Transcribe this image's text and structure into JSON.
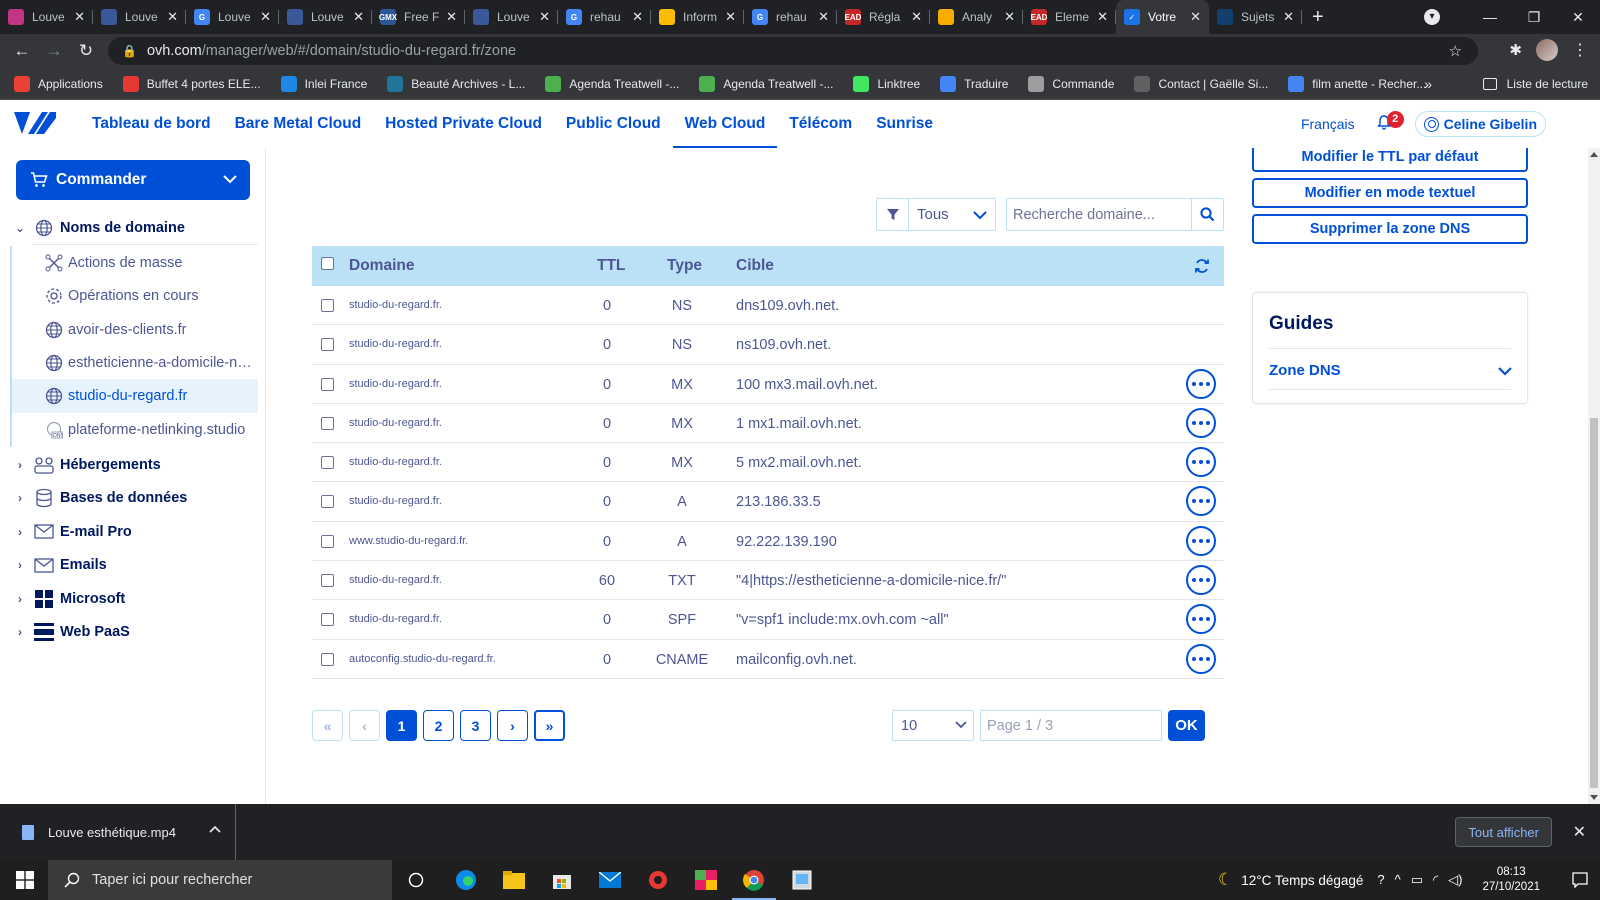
{
  "browser": {
    "tabs": [
      {
        "title": "Louve",
        "fav_color": "#c13584",
        "fav_text": ""
      },
      {
        "title": "Louve",
        "fav_color": "#3b5998",
        "fav_text": ""
      },
      {
        "title": "Louve",
        "fav_color": "#4285f4",
        "fav_text": "G"
      },
      {
        "title": "Louve",
        "fav_color": "#3b5998",
        "fav_text": ""
      },
      {
        "title": "Free F",
        "fav_color": "#2b5797",
        "fav_text": "GMX"
      },
      {
        "title": "Louve",
        "fav_color": "#3b5998",
        "fav_text": ""
      },
      {
        "title": "rehau",
        "fav_color": "#4285f4",
        "fav_text": "G"
      },
      {
        "title": "Inform",
        "fav_color": "#fbbc04",
        "fav_text": ""
      },
      {
        "title": "rehau",
        "fav_color": "#4285f4",
        "fav_text": "G"
      },
      {
        "title": "Régla",
        "fav_color": "#c62828",
        "fav_text": "EAD"
      },
      {
        "title": "Analy",
        "fav_color": "#f9ab00",
        "fav_text": ""
      },
      {
        "title": "Eleme",
        "fav_color": "#c62828",
        "fav_text": "EAD"
      },
      {
        "title": "Votre",
        "fav_color": "#1a73e8",
        "fav_text": "✓",
        "active": true
      },
      {
        "title": "Sujets",
        "fav_color": "#123f6d",
        "fav_text": ""
      }
    ],
    "url_host": "ovh.com",
    "url_path": "/manager/web/#/domain/studio-du-regard.fr/zone",
    "bookmarks": [
      {
        "label": "Applications",
        "color": "#ea4335"
      },
      {
        "label": "Buffet 4 portes ELE...",
        "color": "#e53935"
      },
      {
        "label": "Inlei France",
        "color": "#1e88e5"
      },
      {
        "label": "Beauté Archives - L...",
        "color": "#21759b"
      },
      {
        "label": "Agenda Treatwell -...",
        "color": "#4caf50"
      },
      {
        "label": "Agenda Treatwell -...",
        "color": "#4caf50"
      },
      {
        "label": "Linktree",
        "color": "#43e660"
      },
      {
        "label": "Traduire",
        "color": "#4285f4"
      },
      {
        "label": "Commande",
        "color": "#9e9e9e"
      },
      {
        "label": "Contact | Gaëlle Si...",
        "color": "#616161"
      },
      {
        "label": "film anette - Recher...",
        "color": "#4285f4"
      }
    ],
    "more_bookmarks": "»",
    "reading_list": "Liste de lecture"
  },
  "ovh_nav": {
    "links": [
      "Tableau de bord",
      "Bare Metal Cloud",
      "Hosted Private Cloud",
      "Public Cloud",
      "Web Cloud",
      "Télécom",
      "Sunrise"
    ],
    "active": "Web Cloud",
    "language": "Français",
    "notifications": "2",
    "user": "Celine Gibelin"
  },
  "sidebar": {
    "order_button": "Commander",
    "domains_label": "Noms de domaine",
    "domain_children": [
      {
        "label": "Actions de masse",
        "icon": "bulk-actions-icon"
      },
      {
        "label": "Opérations en cours",
        "icon": "gear-icon"
      },
      {
        "label": "avoir-des-clients.fr",
        "icon": "globe-icon"
      },
      {
        "label": "estheticienne-a-domicile-nice.fr",
        "icon": "globe-icon"
      },
      {
        "label": "studio-du-regard.fr",
        "icon": "globe-icon",
        "selected": true
      },
      {
        "label": "plateforme-netlinking.studio",
        "icon": "dns-icon"
      }
    ],
    "sections": [
      {
        "label": "Hébergements",
        "icon": "hosting-icon"
      },
      {
        "label": "Bases de données",
        "icon": "database-icon"
      },
      {
        "label": "E-mail Pro",
        "icon": "mail-icon"
      },
      {
        "label": "Emails",
        "icon": "mail-icon"
      },
      {
        "label": "Microsoft",
        "icon": "microsoft-icon"
      },
      {
        "label": "Web PaaS",
        "icon": "webpaas-icon"
      }
    ]
  },
  "zone": {
    "filter_value": "Tous",
    "search_placeholder": "Recherche domaine...",
    "columns": {
      "domain": "Domaine",
      "ttl": "TTL",
      "type": "Type",
      "target": "Cible"
    },
    "records": [
      {
        "domain": "studio-du-regard.fr.",
        "ttl": "0",
        "type": "NS",
        "target": "dns109.ovh.net.",
        "actions": false
      },
      {
        "domain": "studio-du-regard.fr.",
        "ttl": "0",
        "type": "NS",
        "target": "ns109.ovh.net.",
        "actions": false
      },
      {
        "domain": "studio-du-regard.fr.",
        "ttl": "0",
        "type": "MX",
        "target": "100 mx3.mail.ovh.net.",
        "actions": true
      },
      {
        "domain": "studio-du-regard.fr.",
        "ttl": "0",
        "type": "MX",
        "target": "1 mx1.mail.ovh.net.",
        "actions": true
      },
      {
        "domain": "studio-du-regard.fr.",
        "ttl": "0",
        "type": "MX",
        "target": "5 mx2.mail.ovh.net.",
        "actions": true
      },
      {
        "domain": "studio-du-regard.fr.",
        "ttl": "0",
        "type": "A",
        "target": "213.186.33.5",
        "actions": true
      },
      {
        "domain": "www.studio-du-regard.fr.",
        "ttl": "0",
        "type": "A",
        "target": "92.222.139.190",
        "actions": true
      },
      {
        "domain": "studio-du-regard.fr.",
        "ttl": "60",
        "type": "TXT",
        "target": "\"4|https://estheticienne-a-domicile-nice.fr/\"",
        "actions": true
      },
      {
        "domain": "studio-du-regard.fr.",
        "ttl": "0",
        "type": "SPF",
        "target": "\"v=spf1 include:mx.ovh.com ~all\"",
        "actions": true
      },
      {
        "domain": "autoconfig.studio-du-regard.fr.",
        "ttl": "0",
        "type": "CNAME",
        "target": "mailconfig.ovh.net.",
        "actions": true
      }
    ],
    "pagination": {
      "first": "«",
      "prev": "‹",
      "pages": [
        "1",
        "2",
        "3"
      ],
      "current": "1",
      "next": "›",
      "last": "»",
      "per_page": "10",
      "page_placeholder": "Page 1 / 3",
      "ok": "OK"
    },
    "actions": {
      "modify_ttl": "Modifier le TTL par défaut",
      "text_mode": "Modifier en mode textuel",
      "delete_zone": "Supprimer la zone DNS"
    },
    "guides": {
      "title": "Guides",
      "item": "Zone DNS"
    }
  },
  "download_bar": {
    "file": "Louve esthétique.mp4",
    "show_all": "Tout afficher"
  },
  "taskbar": {
    "search_placeholder": "Taper ici pour rechercher",
    "weather": "12°C  Temps dégagé",
    "time": "08:13",
    "date": "27/10/2021"
  },
  "colors": {
    "ovh_blue": "#0050d7",
    "ovh_navy": "#00185e",
    "table_head": "#bbe1f7",
    "text_muted": "#4d5693"
  }
}
